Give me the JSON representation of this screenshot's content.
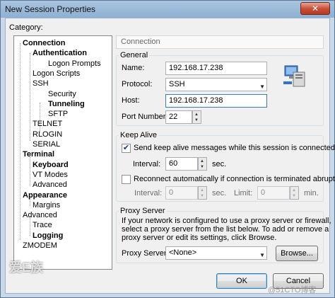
{
  "window": {
    "title": "New Session Properties",
    "close_glyph": "✕"
  },
  "category_label": "Category:",
  "tree": [
    {
      "label": "Connection",
      "bold": true
    },
    {
      "label": "Authentication",
      "bold": true
    },
    {
      "label": "Logon Prompts",
      "bold": false
    },
    {
      "label": "Logon Scripts",
      "bold": false
    },
    {
      "label": "SSH",
      "bold": false
    },
    {
      "label": "Security",
      "bold": false
    },
    {
      "label": "Tunneling",
      "bold": true
    },
    {
      "label": "SFTP",
      "bold": false
    },
    {
      "label": "TELNET",
      "bold": false
    },
    {
      "label": "RLOGIN",
      "bold": false
    },
    {
      "label": "SERIAL",
      "bold": false
    },
    {
      "label": "Terminal",
      "bold": true
    },
    {
      "label": "Keyboard",
      "bold": true
    },
    {
      "label": "VT Modes",
      "bold": false
    },
    {
      "label": "Advanced",
      "bold": false
    },
    {
      "label": "Appearance",
      "bold": true
    },
    {
      "label": "Margins",
      "bold": false
    },
    {
      "label": "Advanced",
      "bold": false
    },
    {
      "label": "Trace",
      "bold": false
    },
    {
      "label": "Logging",
      "bold": true
    },
    {
      "label": "ZMODEM",
      "bold": false
    }
  ],
  "panel_title": "Connection",
  "general": {
    "title": "General",
    "name_label": "Name:",
    "name_value": "192.168.17.238",
    "protocol_label": "Protocol:",
    "protocol_value": "SSH",
    "host_label": "Host:",
    "host_value": "192.168.17.238",
    "port_label": "Port Number:",
    "port_value": "22"
  },
  "keepalive": {
    "title": "Keep Alive",
    "send_label": "Send keep alive messages while this session is connected",
    "send_checked": true,
    "interval_label": "Interval:",
    "interval_value": "60",
    "interval_unit": "sec.",
    "reconnect_label": "Reconnect automatically if connection is terminated abruptly",
    "reconnect_checked": false,
    "r_interval_label": "Interval:",
    "r_interval_value": "0",
    "r_interval_unit": "sec.",
    "limit_label": "Limit:",
    "limit_value": "0",
    "limit_unit": "min."
  },
  "proxy": {
    "title": "Proxy Server",
    "desc_line1": "If your network is configured to use a proxy server or firewall,",
    "desc_line2": "select a proxy server from the list below. To add or remove a",
    "desc_line3": "proxy server or edit its settings, click Browse.",
    "label": "Proxy Server:",
    "value": "<None>",
    "browse": "Browse..."
  },
  "buttons": {
    "ok": "OK",
    "cancel": "Cancel"
  },
  "watermarks": {
    "left": "爱E族",
    "right": "@51CTO博客"
  },
  "colors": {
    "accent": "#3c7fb1",
    "title_bar": "#a9c4e0",
    "close": "#c74b33"
  }
}
